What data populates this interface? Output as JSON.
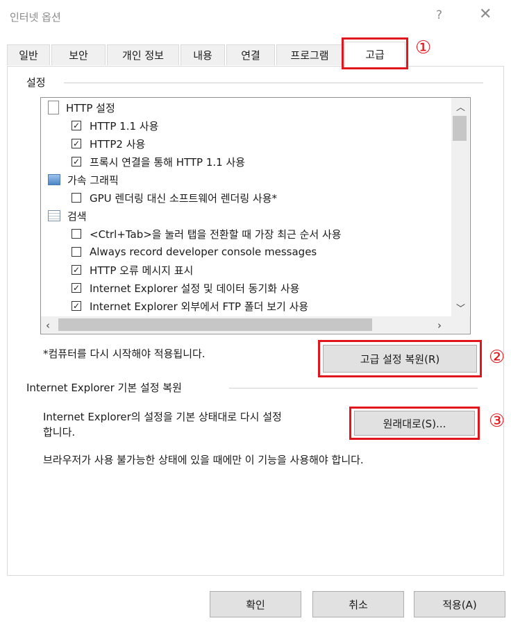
{
  "window": {
    "title": "인터넷 옵션",
    "help_glyph": "?",
    "close_glyph": "✕"
  },
  "tabs": [
    {
      "label": "일반"
    },
    {
      "label": "보안"
    },
    {
      "label": "개인 정보"
    },
    {
      "label": "내용"
    },
    {
      "label": "연결"
    },
    {
      "label": "프로그램"
    },
    {
      "label": "고급"
    }
  ],
  "settings": {
    "section_label": "설정",
    "items": [
      {
        "kind": "category",
        "icon": "page-icon",
        "label": "HTTP 설정"
      },
      {
        "kind": "checkbox",
        "checked": true,
        "label": "HTTP 1.1 사용"
      },
      {
        "kind": "checkbox",
        "checked": true,
        "label": "HTTP2 사용"
      },
      {
        "kind": "checkbox",
        "checked": true,
        "label": "프록시 연결을 통해 HTTP 1.1 사용"
      },
      {
        "kind": "category",
        "icon": "graphics-icon",
        "label": "가속 그래픽"
      },
      {
        "kind": "checkbox",
        "checked": false,
        "label": "GPU 렌더링 대신 소프트웨어 렌더링 사용*"
      },
      {
        "kind": "category",
        "icon": "search-list-icon",
        "label": "검색"
      },
      {
        "kind": "checkbox",
        "checked": false,
        "label": "<Ctrl+Tab>을 눌러 탭을 전환할 때 가장 최근 순서 사용"
      },
      {
        "kind": "checkbox",
        "checked": false,
        "label": "Always record developer console messages"
      },
      {
        "kind": "checkbox",
        "checked": true,
        "label": "HTTP 오류 메시지 표시"
      },
      {
        "kind": "checkbox",
        "checked": true,
        "label": "Internet Explorer 설정 및 데이터 동기화 사용"
      },
      {
        "kind": "checkbox",
        "checked": true,
        "label": "Internet Explorer 외부에서 FTP 폴더 보기 사용"
      }
    ],
    "restart_note": "*컴퓨터를 다시 시작해야 적용됩니다.",
    "restore_advanced_button": "고급 설정 복원(R)"
  },
  "reset": {
    "section_label": "Internet Explorer 기본 설정 복원",
    "description_line1": "Internet Explorer의 설정을 기본 상태대로 다시 설정",
    "description_line2": "합니다.",
    "reset_button": "원래대로(S)...",
    "warning": "브라우저가 사용 불가능한 상태에 있을 때에만 이 기능을 사용해야 합니다."
  },
  "annotations": {
    "one": "①",
    "two": "②",
    "three": "③",
    "color": "#e0161c"
  },
  "footer": {
    "ok": "확인",
    "cancel": "취소",
    "apply": "적용(A)"
  }
}
